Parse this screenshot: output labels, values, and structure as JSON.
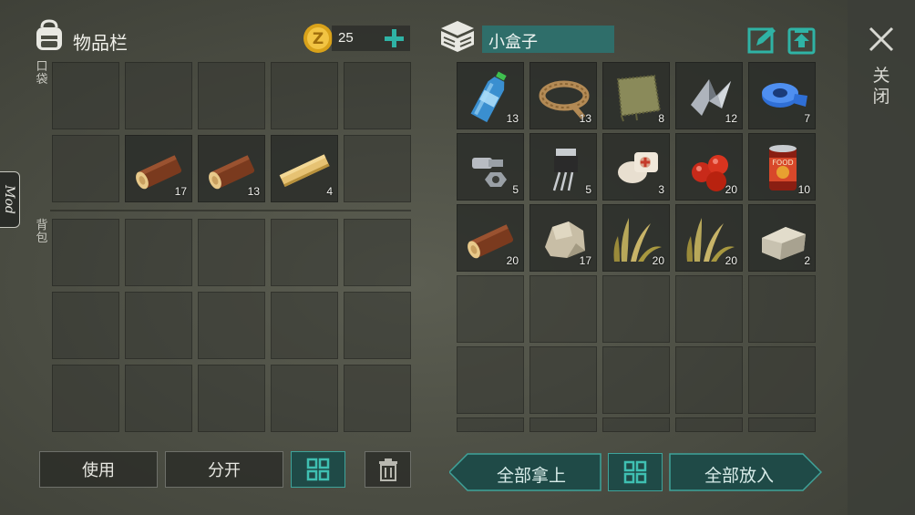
{
  "left_panel": {
    "title": "物品栏",
    "coins": "25",
    "pocket_label": "口袋",
    "backpack_label": "背包",
    "mod_tab": "Mod"
  },
  "right_panel": {
    "container_name": "小盒子",
    "close_label": "关闭"
  },
  "buttons": {
    "use": "使用",
    "split": "分开",
    "take_all": "全部拿上",
    "put_all": "全部放入"
  },
  "pocket_items": [
    {
      "slot": 6,
      "icon": "log-icon",
      "count": "17"
    },
    {
      "slot": 7,
      "icon": "log-icon",
      "count": "13"
    },
    {
      "slot": 8,
      "icon": "plank-icon",
      "count": "4"
    }
  ],
  "container_items": [
    {
      "icon": "water-bottle-icon",
      "count": "13"
    },
    {
      "icon": "rope-icon",
      "count": "13"
    },
    {
      "icon": "cloth-icon",
      "count": "8"
    },
    {
      "icon": "scrap-metal-icon",
      "count": "12"
    },
    {
      "icon": "duct-tape-icon",
      "count": "7"
    },
    {
      "icon": "bolt-nut-icon",
      "count": "5"
    },
    {
      "icon": "transistor-icon",
      "count": "5"
    },
    {
      "icon": "bandage-icon",
      "count": "3"
    },
    {
      "icon": "berries-icon",
      "count": "20"
    },
    {
      "icon": "canned-food-icon",
      "count": "10"
    },
    {
      "icon": "log-icon",
      "count": "20"
    },
    {
      "icon": "stone-icon",
      "count": "17"
    },
    {
      "icon": "plant-fiber-icon",
      "count": "20"
    },
    {
      "icon": "plant-fiber-icon",
      "count": "20"
    },
    {
      "icon": "stone-brick-icon",
      "count": "2"
    }
  ],
  "colors": {
    "accent_teal": "#3fa39a",
    "name_field": "#2f6e6a"
  }
}
